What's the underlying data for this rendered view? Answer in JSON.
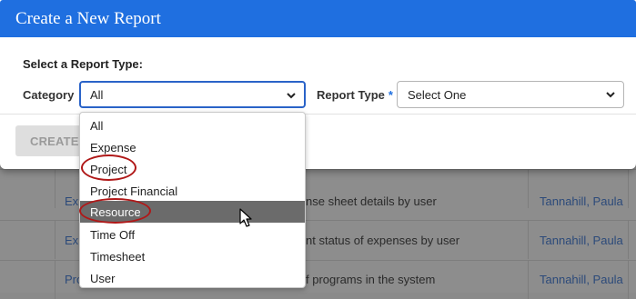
{
  "modal": {
    "title": "Create a New Report",
    "section_label": "Select a Report Type:",
    "category_label": "Category",
    "category_value": "All",
    "report_type_label": "Report Type",
    "required_marker": "*",
    "report_type_value": "Select One",
    "create_button": "CREATE"
  },
  "dropdown": {
    "options": [
      "All",
      "Expense",
      "Project",
      "Project Financial",
      "Resource",
      "Time Off",
      "Timesheet",
      "User"
    ],
    "highlighted": "Resource",
    "circled": [
      "Project",
      "Resource"
    ]
  },
  "background_table": {
    "rows": [
      {
        "link": "Exp",
        "description": "nse sheet details by user",
        "owner": "Tannahill, Paula"
      },
      {
        "link": "Exp",
        "description": "nt status of expenses by user",
        "owner": "Tannahill, Paula"
      },
      {
        "link": "Pro",
        "description": "f programs in the system",
        "owner": "Tannahill, Paula"
      }
    ]
  },
  "colors": {
    "header_blue": "#1f6fe0",
    "highlight_gray": "#6b6b6b",
    "annotation_red": "#b01818"
  },
  "icons": [
    "chevron-down-icon",
    "mouse-pointer-icon"
  ]
}
